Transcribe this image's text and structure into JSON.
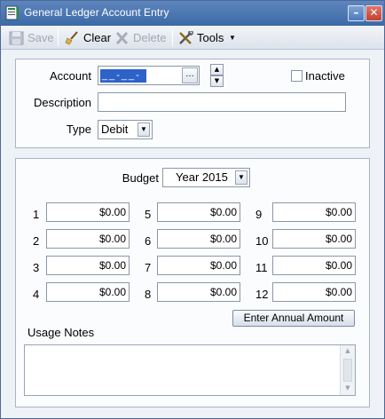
{
  "window": {
    "title": "General Ledger Account Entry"
  },
  "toolbar": {
    "save": "Save",
    "clear": "Clear",
    "delete": "Delete",
    "tools": "Tools"
  },
  "account": {
    "label": "Account",
    "value": "__-__-_",
    "inactive_label": "Inactive",
    "inactive_checked": false,
    "description_label": "Description",
    "description_value": "",
    "type_label": "Type",
    "type_value": "Debit"
  },
  "budget": {
    "label": "Budget",
    "year": "Year 2015",
    "periods": [
      {
        "num": "1",
        "amount": "$0.00"
      },
      {
        "num": "2",
        "amount": "$0.00"
      },
      {
        "num": "3",
        "amount": "$0.00"
      },
      {
        "num": "4",
        "amount": "$0.00"
      },
      {
        "num": "5",
        "amount": "$0.00"
      },
      {
        "num": "6",
        "amount": "$0.00"
      },
      {
        "num": "7",
        "amount": "$0.00"
      },
      {
        "num": "8",
        "amount": "$0.00"
      },
      {
        "num": "9",
        "amount": "$0.00"
      },
      {
        "num": "10",
        "amount": "$0.00"
      },
      {
        "num": "11",
        "amount": "$0.00"
      },
      {
        "num": "12",
        "amount": "$0.00"
      }
    ],
    "annual_button": "Enter Annual Amount"
  },
  "notes": {
    "label": "Usage Notes",
    "value": ""
  }
}
